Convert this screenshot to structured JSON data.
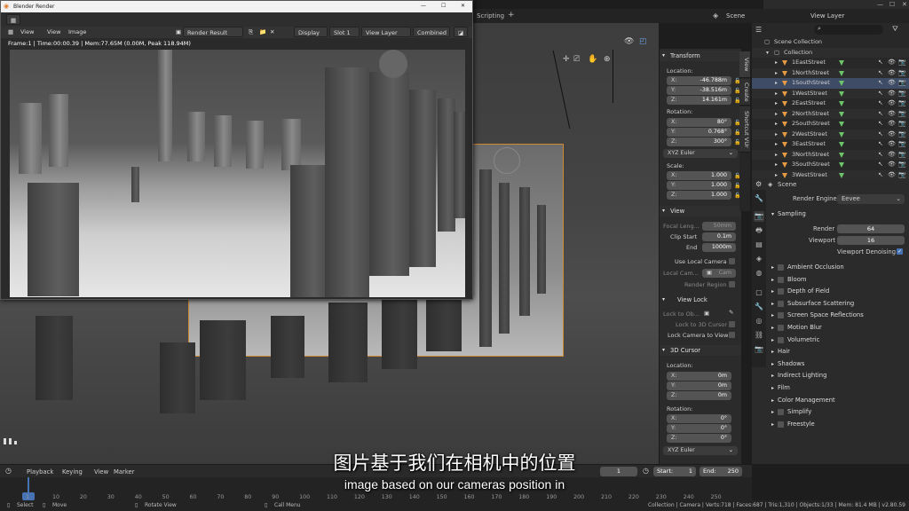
{
  "header": {
    "workspace_tab": "Scripting",
    "scene_label": "Scene",
    "view_layer_label": "View Layer"
  },
  "render_window": {
    "title": "Blender Render",
    "menu": [
      "View",
      "View",
      "Image"
    ],
    "render_result": "Render Result",
    "display": "Display",
    "slot": "Slot 1",
    "view_layer": "View Layer",
    "pass": "Combined",
    "info": "Frame:1 | Time:00:00.39 | Mem:77.65M (0.00M, Peak 118.94M)"
  },
  "n_panel": {
    "tabs": [
      "View",
      "Create",
      "Shortcut VUr"
    ],
    "transform_header": "Transform",
    "location_label": "Location:",
    "location": [
      {
        "k": "X:",
        "v": "-46.788m"
      },
      {
        "k": "Y:",
        "v": "-38.516m"
      },
      {
        "k": "Z:",
        "v": "14.161m"
      }
    ],
    "rotation_label": "Rotation:",
    "rotation": [
      {
        "k": "X:",
        "v": "80°"
      },
      {
        "k": "Y:",
        "v": "0.768°"
      },
      {
        "k": "Z:",
        "v": "300°"
      }
    ],
    "rotation_mode": "XYZ Euler",
    "scale_label": "Scale:",
    "scale": [
      {
        "k": "X:",
        "v": "1.000"
      },
      {
        "k": "Y:",
        "v": "1.000"
      },
      {
        "k": "Z:",
        "v": "1.000"
      }
    ],
    "view_header": "View",
    "focal_label": "Focal Leng...",
    "focal_value": "50mm",
    "clip_start_label": "Clip Start",
    "clip_start_value": "0.1m",
    "end_label": "End",
    "end_value": "1000m",
    "use_local_camera": "Use Local Camera",
    "local_cam_label": "Local Cam...",
    "local_cam_value": "Cam",
    "render_region": "Render Region",
    "view_lock_header": "View Lock",
    "lock_to_obj_label": "Lock to Ob...",
    "lock_3d_cursor": "Lock to 3D Cursor",
    "lock_camera_view": "Lock Camera to View",
    "cursor_header": "3D Cursor",
    "cursor_location_label": "Location:",
    "cursor_location": [
      {
        "k": "X:",
        "v": "0m"
      },
      {
        "k": "Y:",
        "v": "0m"
      },
      {
        "k": "Z:",
        "v": "0m"
      }
    ],
    "cursor_rotation_label": "Rotation:",
    "cursor_rotation": [
      {
        "k": "X:",
        "v": "0°"
      },
      {
        "k": "Y:",
        "v": "0°"
      },
      {
        "k": "Z:",
        "v": "0°"
      }
    ],
    "cursor_rotation_mode": "XYZ Euler"
  },
  "outliner": {
    "scene_collection": "Scene Collection",
    "collection": "Collection",
    "items": [
      "1EastStreet",
      "1NorthStreet",
      "1SouthStreet",
      "1WestStreet",
      "2EastStreet",
      "2NorthStreet",
      "2SouthStreet",
      "2WestStreet",
      "3EastStreet",
      "3NorthStreet",
      "3SouthStreet",
      "3WestStreet"
    ]
  },
  "properties": {
    "scene": "Scene",
    "render_engine_label": "Render Engine",
    "render_engine": "Eevee",
    "sampling": "Sampling",
    "render_label": "Render",
    "render_value": "64",
    "viewport_label": "Viewport",
    "viewport_value": "16",
    "viewport_denoising": "Viewport Denoising",
    "sections_cb": [
      "Ambient Occlusion",
      "Bloom",
      "Depth of Field",
      "Subsurface Scattering",
      "Screen Space Reflections",
      "Motion Blur",
      "Volumetric"
    ],
    "sections": [
      "Hair",
      "Shadows",
      "Indirect Lighting",
      "Film",
      "Color Management"
    ],
    "sections_cb2": [
      "Simplify",
      "Freestyle"
    ]
  },
  "timeline": {
    "menus": [
      "Playback",
      "Keying",
      "View",
      "Marker"
    ],
    "current_frame": "1",
    "start_label": "Start:",
    "start_value": "1",
    "end_label": "End:",
    "end_value": "250",
    "ticks": [
      "1",
      "10",
      "20",
      "30",
      "40",
      "50",
      "60",
      "70",
      "80",
      "90",
      "100",
      "110",
      "120",
      "130",
      "140",
      "150",
      "160",
      "170",
      "180",
      "190",
      "200",
      "210",
      "220",
      "230",
      "240",
      "250"
    ]
  },
  "statusbar": {
    "select": "Select",
    "move": "Move",
    "rotate": "Rotate View",
    "call_menu": "Call Menu",
    "stats": "Collection | Camera | Verts:718 | Faces:687 | Tris:1,310 | Objects:1/33 | Mem: 81.4 MB | v2.80.59"
  },
  "subtitles": {
    "chinese": "图片基于我们在相机中的位置",
    "english": "image based on our cameras position in"
  },
  "colors": {
    "accent": "#4772b3",
    "camera": "#e59a43",
    "mesh": "#6dc46a"
  }
}
